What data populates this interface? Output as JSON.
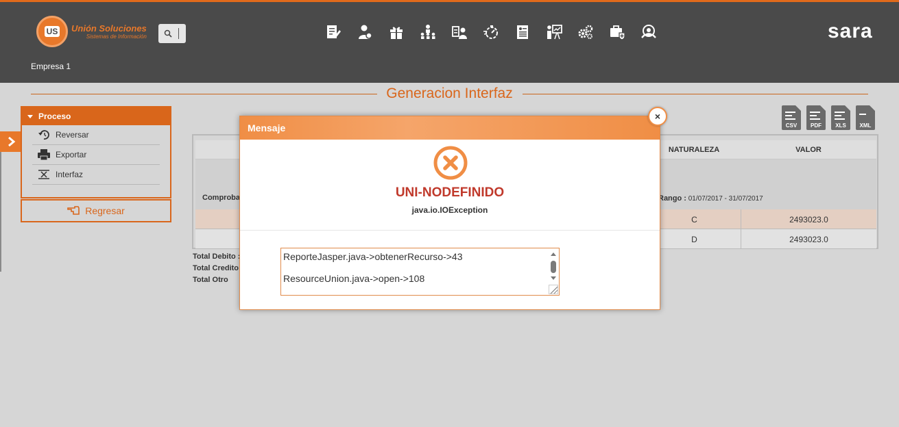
{
  "header": {
    "logo_badge": "US",
    "logo_line1": "Unión Soluciones",
    "logo_line2": "Sistemas de Información",
    "brand": "sara",
    "company": "Empresa 1",
    "nav_icons": [
      "document-edit-icon",
      "user-money-icon",
      "gift-icon",
      "org-chart-icon",
      "id-card-user-icon",
      "timer-icon",
      "form-icon",
      "presentation-icon",
      "gears-icon",
      "medical-case-icon",
      "support-search-icon"
    ]
  },
  "page": {
    "title": "Generacion Interfaz"
  },
  "sidebar": {
    "section_title": "Proceso",
    "items": [
      {
        "label": "Reversar",
        "icon": "undo-icon"
      },
      {
        "label": "Exportar",
        "icon": "printer-icon"
      },
      {
        "label": "Interfaz",
        "icon": "interface-icon"
      }
    ],
    "back_label": "Regresar"
  },
  "exports": [
    "CSV",
    "PDF",
    "XLS",
    "XML"
  ],
  "table": {
    "headers": {
      "naturaleza": "NATURALEZA",
      "valor": "VALOR"
    },
    "group": {
      "left_label": "Comprobante",
      "range_label": "Rango :",
      "range_value": "01/07/2017 - 31/07/2017"
    },
    "rows": [
      {
        "naturaleza": "C",
        "valor": "2493023.0"
      },
      {
        "naturaleza": "D",
        "valor": "2493023.0"
      }
    ],
    "totals": [
      "Total Debito :",
      "Total Credito:",
      "Total Otro"
    ]
  },
  "dialog": {
    "title": "Mensaje",
    "close": "×",
    "code": "UNI-NODEFINIDO",
    "subtitle": "java.io.IOException",
    "trace": [
      "ReporteJasper.java->obtenerRecurso->43",
      "ResourceUnion.java->open->108"
    ]
  },
  "colors": {
    "accent": "#d9661b",
    "header_bg": "#4a4a4a",
    "page_bg": "#d6d6d6",
    "error_red": "#c0392b"
  }
}
